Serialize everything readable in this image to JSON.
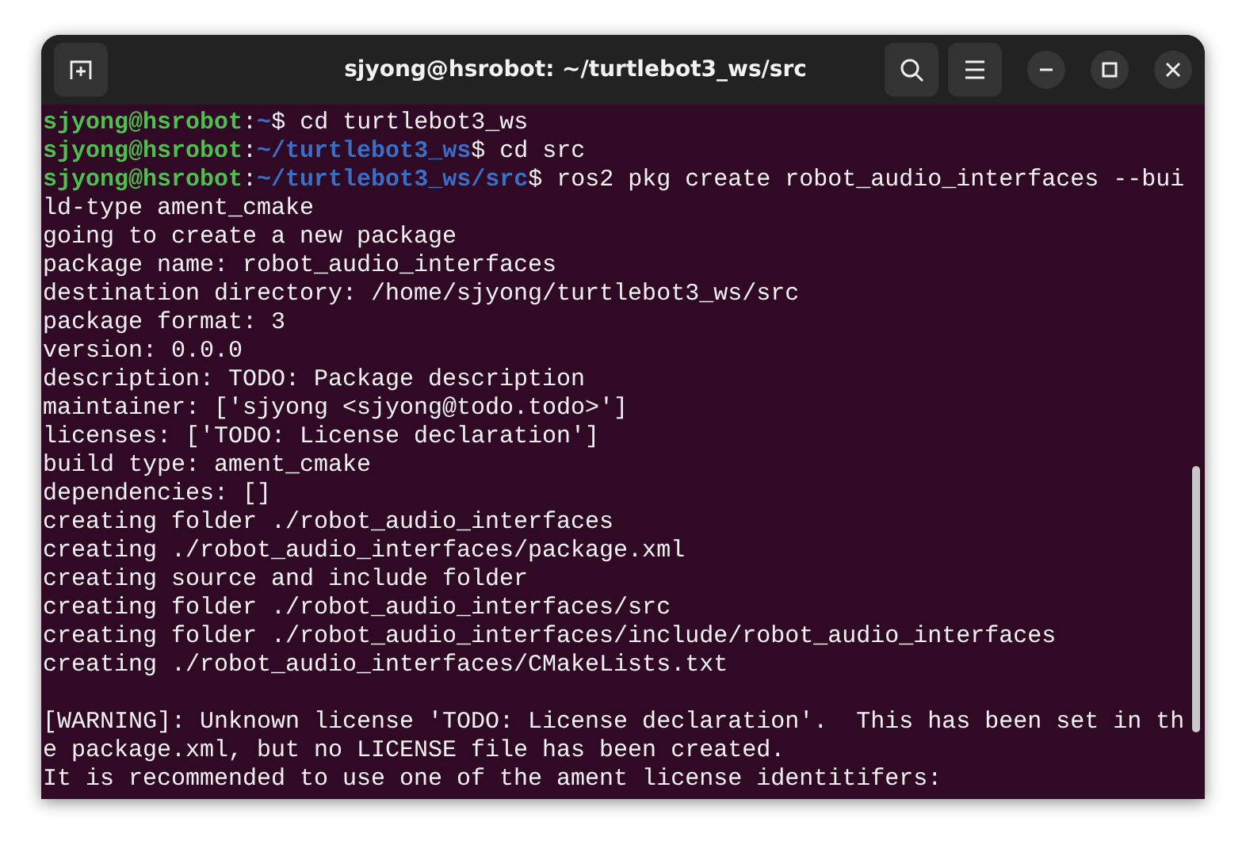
{
  "window": {
    "title": "sjyong@hsrobot: ~/turtlebot3_ws/src"
  },
  "terminal": {
    "lines": [
      {
        "kind": "prompt",
        "user_host": "sjyong@hsrobot",
        "separator": ":",
        "path": "~",
        "command": "$ cd turtlebot3_ws"
      },
      {
        "kind": "prompt",
        "user_host": "sjyong@hsrobot",
        "separator": ":",
        "path": "~/turtlebot3_ws",
        "command": "$ cd src"
      },
      {
        "kind": "prompt",
        "user_host": "sjyong@hsrobot",
        "separator": ":",
        "path": "~/turtlebot3_ws/src",
        "command": "$ ros2 pkg create robot_audio_interfaces --bui"
      },
      {
        "kind": "output",
        "text": "ld-type ament_cmake"
      },
      {
        "kind": "output",
        "text": "going to create a new package"
      },
      {
        "kind": "output",
        "text": "package name: robot_audio_interfaces"
      },
      {
        "kind": "output",
        "text": "destination directory: /home/sjyong/turtlebot3_ws/src"
      },
      {
        "kind": "output",
        "text": "package format: 3"
      },
      {
        "kind": "output",
        "text": "version: 0.0.0"
      },
      {
        "kind": "output",
        "text": "description: TODO: Package description"
      },
      {
        "kind": "output",
        "text": "maintainer: ['sjyong <sjyong@todo.todo>']"
      },
      {
        "kind": "output",
        "text": "licenses: ['TODO: License declaration']"
      },
      {
        "kind": "output",
        "text": "build type: ament_cmake"
      },
      {
        "kind": "output",
        "text": "dependencies: []"
      },
      {
        "kind": "output",
        "text": "creating folder ./robot_audio_interfaces"
      },
      {
        "kind": "output",
        "text": "creating ./robot_audio_interfaces/package.xml"
      },
      {
        "kind": "output",
        "text": "creating source and include folder"
      },
      {
        "kind": "output",
        "text": "creating folder ./robot_audio_interfaces/src"
      },
      {
        "kind": "output",
        "text": "creating folder ./robot_audio_interfaces/include/robot_audio_interfaces"
      },
      {
        "kind": "output",
        "text": "creating ./robot_audio_interfaces/CMakeLists.txt"
      },
      {
        "kind": "blank"
      },
      {
        "kind": "output",
        "text": "[WARNING]: Unknown license 'TODO: License declaration'.  This has been set in th"
      },
      {
        "kind": "output",
        "text": "e package.xml, but no LICENSE file has been created."
      },
      {
        "kind": "output",
        "text": "It is recommended to use one of the ament license identitifers:"
      }
    ]
  }
}
